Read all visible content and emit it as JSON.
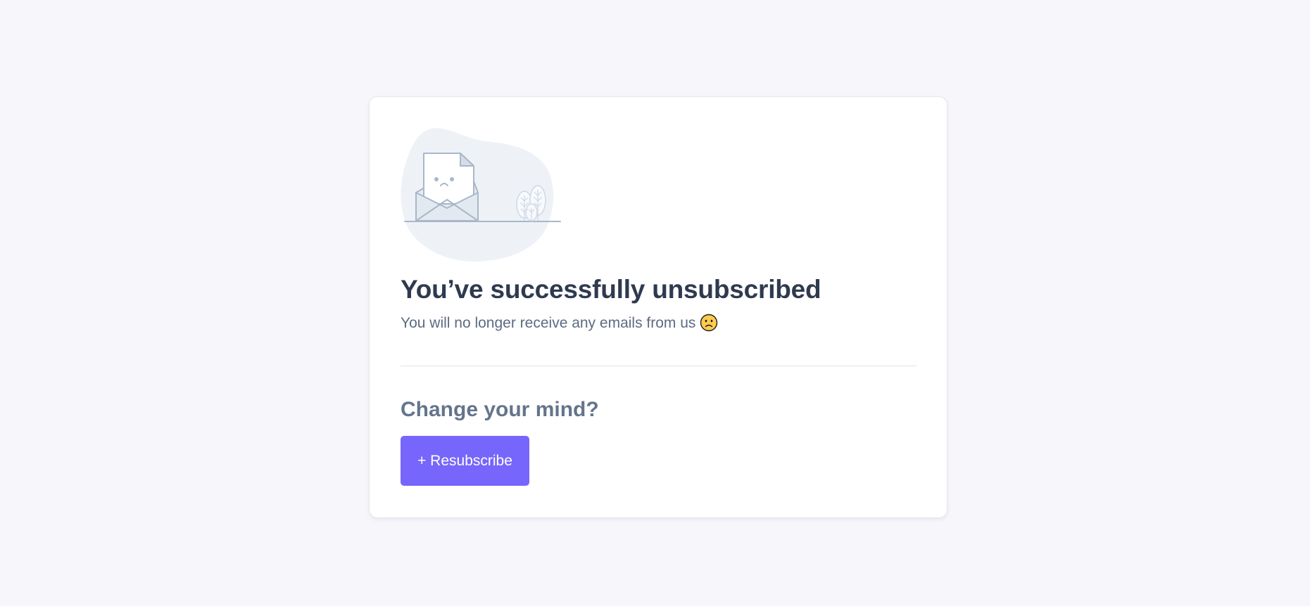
{
  "card": {
    "title": "You’ve successfully unsubscribed",
    "subtitle": "You will no longer receive any emails from us",
    "subtitle_emoji": "slightly-frowning-face-emoji"
  },
  "resubscribe": {
    "heading": "Change your mind?",
    "button_label": "+ Resubscribe"
  },
  "colors": {
    "page_background": "#f7f7fb",
    "card_background": "#ffffff",
    "title": "#2f3a4f",
    "subtitle": "#5c6b82",
    "secondary_heading": "#64748b",
    "accent_button": "#7766fb",
    "illustration_blob": "#eef2f7",
    "illustration_stroke": "#a9b7c9"
  },
  "icons": {
    "illustration": "sad-envelope-illustration",
    "emoji": "slightly-frowning-face-emoji"
  }
}
